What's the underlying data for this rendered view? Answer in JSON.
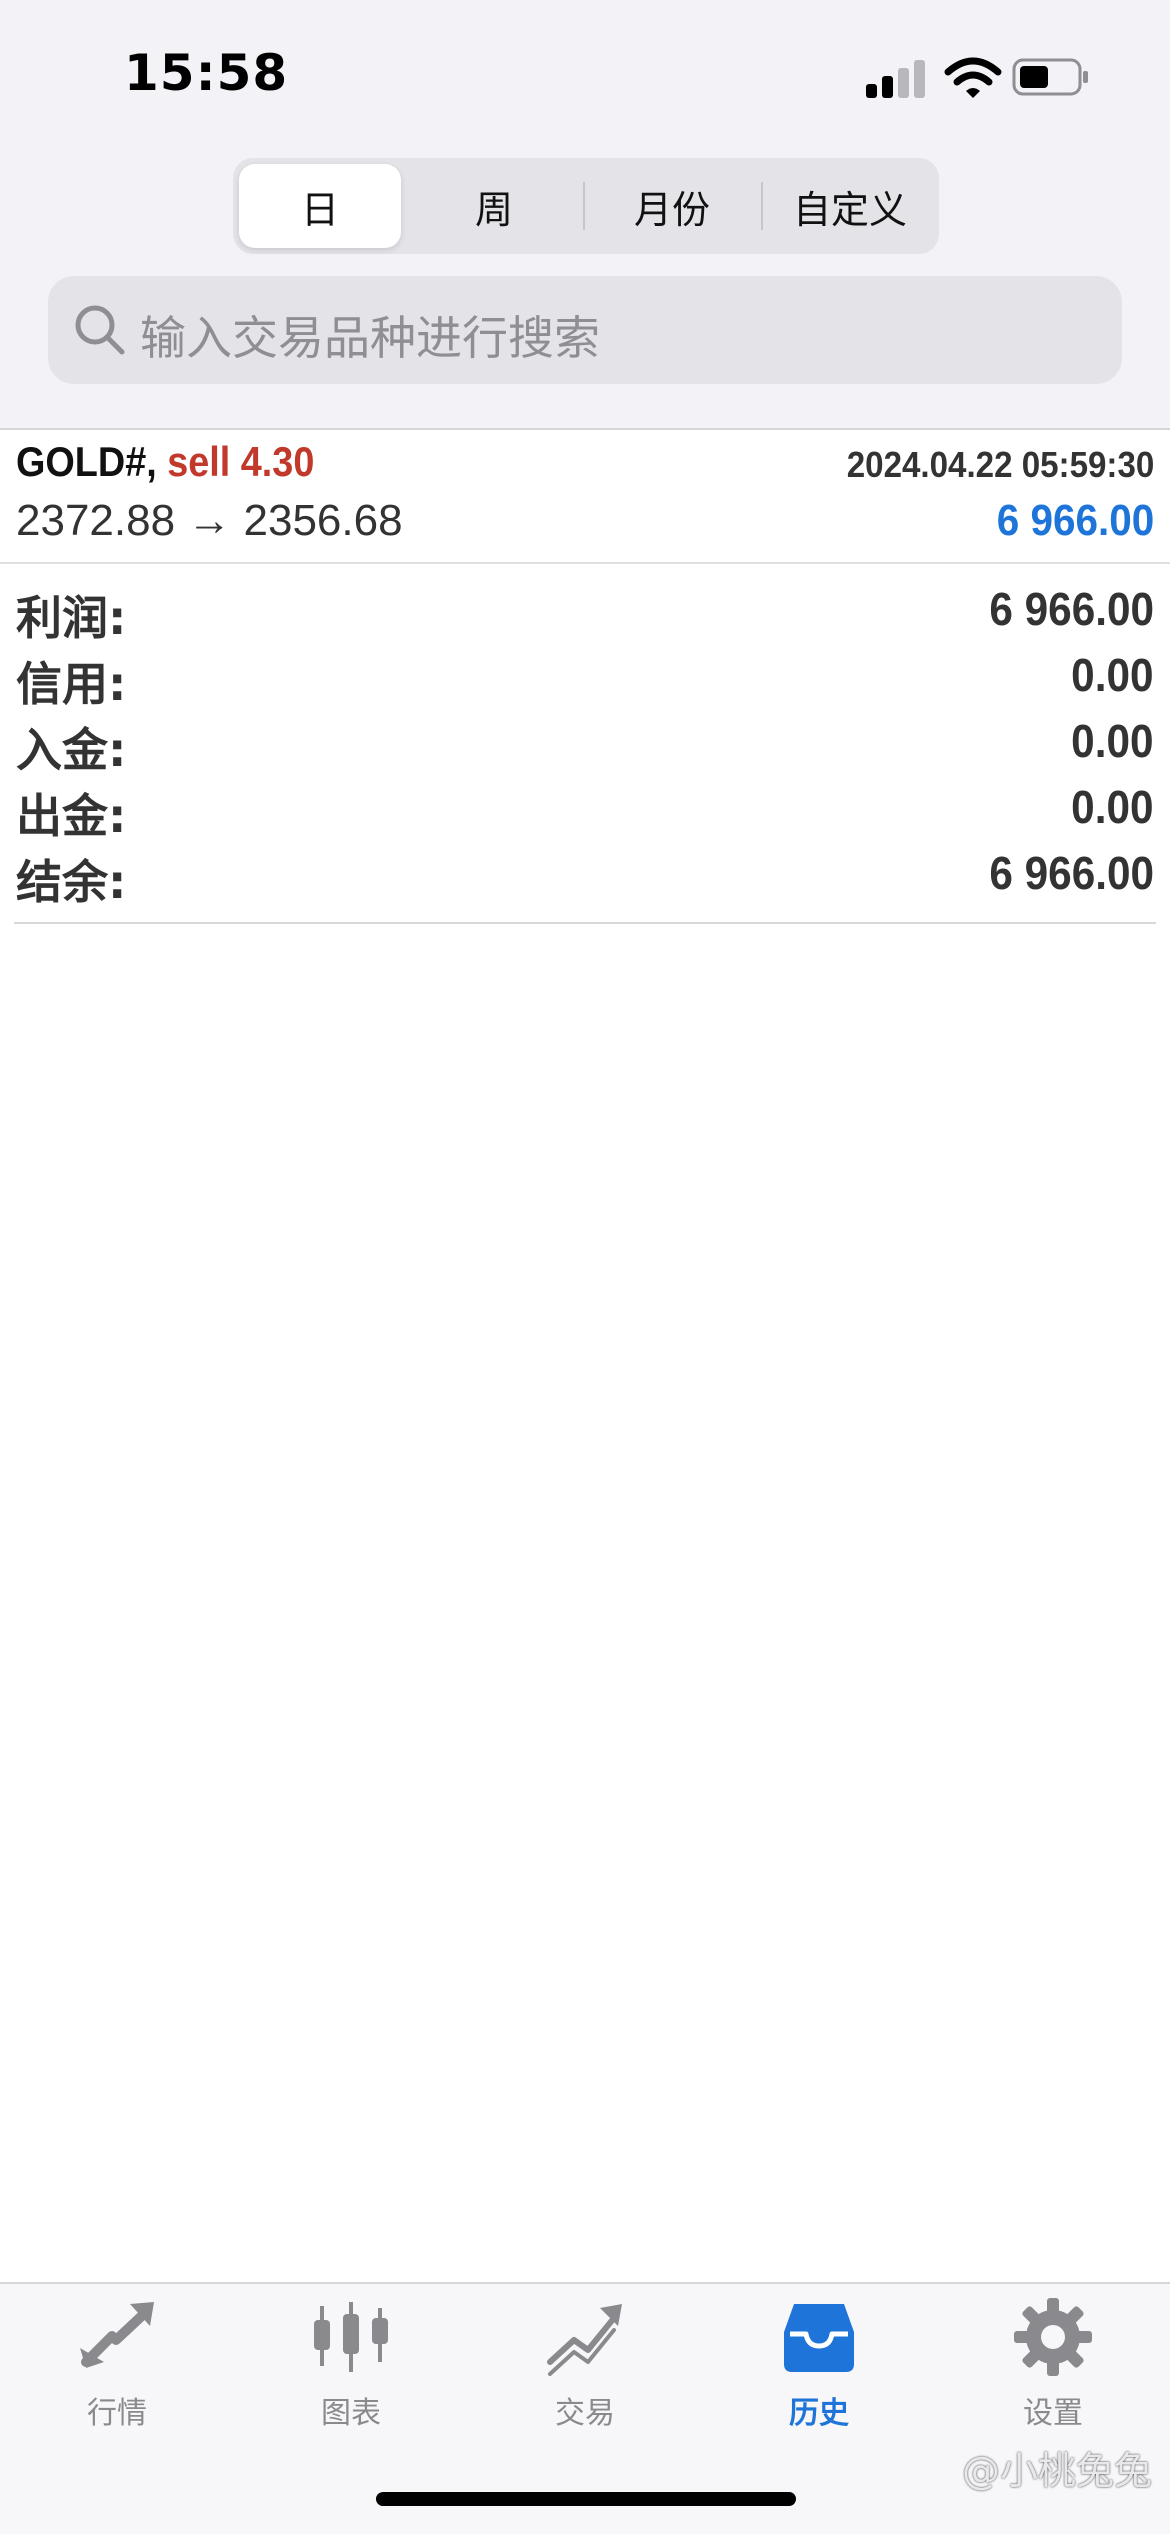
{
  "status_bar": {
    "time": "15:58"
  },
  "period_tabs": [
    {
      "label": "日",
      "active": true
    },
    {
      "label": "周",
      "active": false
    },
    {
      "label": "月份",
      "active": false
    },
    {
      "label": "自定义",
      "active": false
    }
  ],
  "search": {
    "placeholder": "输入交易品种进行搜索"
  },
  "trade": {
    "symbol": "GOLD#,",
    "side_volume": "sell 4.30",
    "datetime": "2024.04.22 05:59:30",
    "prices": "2372.88 → 2356.68",
    "profit": "6 966.00"
  },
  "summary": [
    {
      "label": "利润:",
      "value": "6 966.00"
    },
    {
      "label": "信用:",
      "value": "0.00"
    },
    {
      "label": "入金:",
      "value": "0.00"
    },
    {
      "label": "出金:",
      "value": "0.00"
    },
    {
      "label": "结余:",
      "value": "6 966.00"
    }
  ],
  "tab_bar": [
    {
      "label": "行情",
      "icon": "quotes-arrows-icon",
      "active": false
    },
    {
      "label": "图表",
      "icon": "candlestick-chart-icon",
      "active": false
    },
    {
      "label": "交易",
      "icon": "trade-trend-icon",
      "active": false
    },
    {
      "label": "历史",
      "icon": "history-inbox-icon",
      "active": true
    },
    {
      "label": "设置",
      "icon": "gear-icon",
      "active": false
    }
  ],
  "watermark": "小桃兔兔",
  "colors": {
    "accent": "#1e74d9",
    "sell": "#c0392b"
  }
}
